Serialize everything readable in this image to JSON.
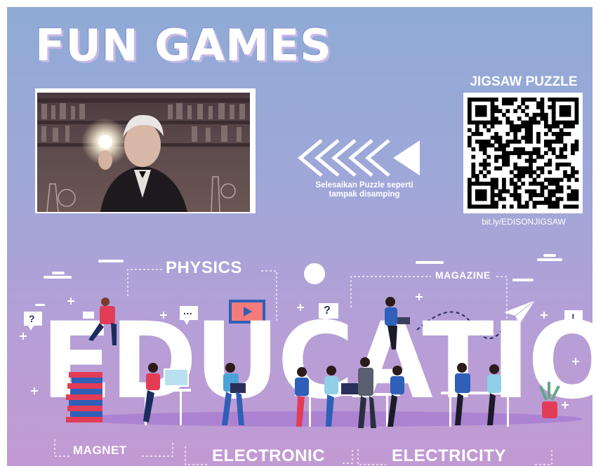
{
  "poster": {
    "title": "FUN GAMES",
    "instruction": "Selesaikan Puzzle seperti tampak disamping",
    "qr_title": "JIGSAW PUZZLE",
    "qr_link": "bit.ly/EDISONJIGSAW"
  },
  "illustration": {
    "big_word": "EDUCATION",
    "labels": {
      "physics": "PHYSICS",
      "magazine": "MAGAZINE",
      "magnet": "MAGNET",
      "electronic": "ELECTRONIC",
      "electricity": "ELECTRICITY"
    },
    "bubbles": {
      "question": "?",
      "dots": "...",
      "exclaim": "!"
    }
  },
  "icons": [
    "lightbulb-photo",
    "arrow-left-icon",
    "qr-code",
    "play-icon",
    "paper-plane-icon",
    "book-stack-icon",
    "plant-icon"
  ],
  "colors": {
    "bg_top": "#8faad6",
    "bg_bottom": "#c29ad3",
    "accent_red": "#e23c57",
    "accent_blue": "#2f5fb7"
  }
}
